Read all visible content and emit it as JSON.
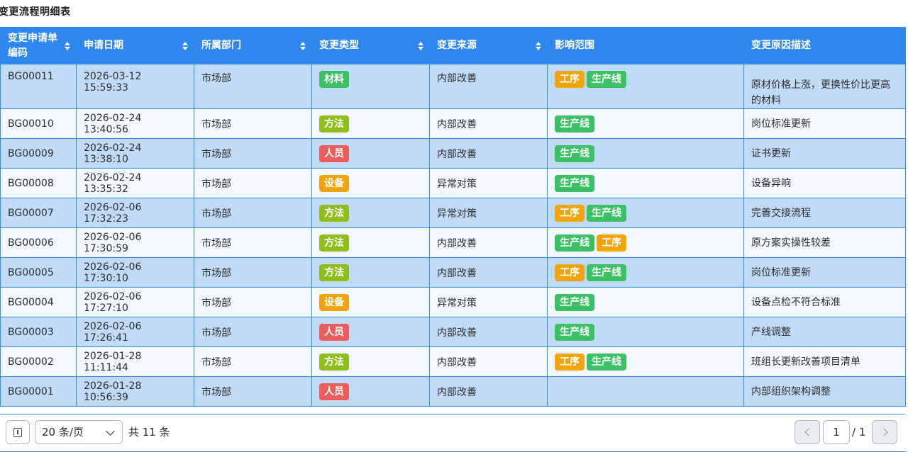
{
  "title": "变更流程明细表",
  "columns": [
    "变更申请单编码",
    "申请日期",
    "所属部门",
    "变更类型",
    "变更来源",
    "影响范围",
    "变更原因描述"
  ],
  "tag_colors": {
    "材料": "#3cc064",
    "方法": "#8fbd1c",
    "人员": "#ea5d5b",
    "设备": "#f0a40e",
    "工序": "#f0a40e",
    "生产线": "#3cc064"
  },
  "rows": [
    {
      "code": "BG00011",
      "date": "2026-03-12 15:59:33",
      "dept": "市场部",
      "type": "材料",
      "source": "内部改善",
      "scope": [
        "工序",
        "生产线"
      ],
      "reason": "原材价格上涨，更换性价比更高的材料"
    },
    {
      "code": "BG00010",
      "date": "2026-02-24 13:40:56",
      "dept": "市场部",
      "type": "方法",
      "source": "内部改善",
      "scope": [
        "生产线"
      ],
      "reason": "岗位标准更新"
    },
    {
      "code": "BG00009",
      "date": "2026-02-24 13:38:10",
      "dept": "市场部",
      "type": "人员",
      "source": "内部改善",
      "scope": [
        "生产线"
      ],
      "reason": "证书更新"
    },
    {
      "code": "BG00008",
      "date": "2026-02-24 13:35:32",
      "dept": "市场部",
      "type": "设备",
      "source": "异常对策",
      "scope": [
        "生产线"
      ],
      "reason": "设备异响"
    },
    {
      "code": "BG00007",
      "date": "2026-02-06 17:32:23",
      "dept": "市场部",
      "type": "方法",
      "source": "异常对策",
      "scope": [
        "工序",
        "生产线"
      ],
      "reason": "完善交接流程"
    },
    {
      "code": "BG00006",
      "date": "2026-02-06 17:30:59",
      "dept": "市场部",
      "type": "方法",
      "source": "内部改善",
      "scope": [
        "生产线",
        "工序"
      ],
      "reason": "原方案实操性较差"
    },
    {
      "code": "BG00005",
      "date": "2026-02-06 17:30:10",
      "dept": "市场部",
      "type": "方法",
      "source": "内部改善",
      "scope": [
        "工序",
        "生产线"
      ],
      "reason": "岗位标准更新"
    },
    {
      "code": "BG00004",
      "date": "2026-02-06 17:27:10",
      "dept": "市场部",
      "type": "设备",
      "source": "异常对策",
      "scope": [
        "生产线"
      ],
      "reason": "设备点检不符合标准"
    },
    {
      "code": "BG00003",
      "date": "2026-02-06 17:26:41",
      "dept": "市场部",
      "type": "人员",
      "source": "内部改善",
      "scope": [
        "生产线"
      ],
      "reason": "产线调整"
    },
    {
      "code": "BG00002",
      "date": "2026-01-28 11:11:44",
      "dept": "市场部",
      "type": "方法",
      "source": "内部改善",
      "scope": [
        "工序",
        "生产线"
      ],
      "reason": "班组长更新改善项目清单"
    },
    {
      "code": "BG00001",
      "date": "2026-01-28 10:56:39",
      "dept": "市场部",
      "type": "人员",
      "source": "内部改善",
      "scope": [],
      "reason": "内部组织架构调整"
    }
  ],
  "pager": {
    "page_size_label": "20 条/页",
    "total_label": "共 11 条",
    "current_page": "1",
    "total_pages_label": "/ 1",
    "toggle_icon": "panel-toggle-icon",
    "prev_icon": "chevron-left-icon",
    "next_icon": "chevron-right-icon"
  }
}
